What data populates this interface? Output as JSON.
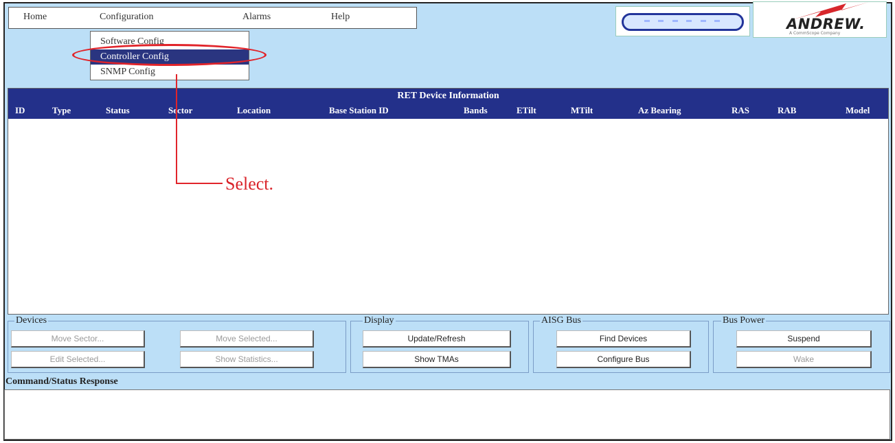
{
  "menu": {
    "home": "Home",
    "configuration": "Configuration",
    "alarms": "Alarms",
    "help": "Help"
  },
  "dropdown": {
    "items": [
      "Software Config",
      "Controller Config",
      "SNMP Config"
    ],
    "selected": "Controller Config"
  },
  "logo": {
    "brand": "ANDREW.",
    "tagline": "A CommScope Company"
  },
  "table": {
    "title": "RET Device Information",
    "columns": [
      "ID",
      "Type",
      "Status",
      "Sector",
      "Location",
      "Base Station ID",
      "Bands",
      "ETilt",
      "MTilt",
      "Az Bearing",
      "RAS",
      "RAB",
      "Model"
    ]
  },
  "callout": {
    "text": "Select."
  },
  "devices": {
    "label": "Devices",
    "move_sector": "Move Sector...",
    "move_selected": "Move Selected...",
    "edit_selected": "Edit Selected...",
    "show_statistics": "Show Statistics..."
  },
  "display": {
    "label": "Display",
    "update_refresh": "Update/Refresh",
    "show_tmas": "Show TMAs"
  },
  "aisg": {
    "label": "AISG Bus",
    "find_devices": "Find Devices",
    "configure_bus": "Configure Bus"
  },
  "bus_power": {
    "label": "Bus Power",
    "suspend": "Suspend",
    "wake": "Wake"
  },
  "status": {
    "label": "Command/Status Response"
  },
  "colors": {
    "background": "#bcdff7",
    "header": "#23308a",
    "highlight": "#e1242a"
  }
}
